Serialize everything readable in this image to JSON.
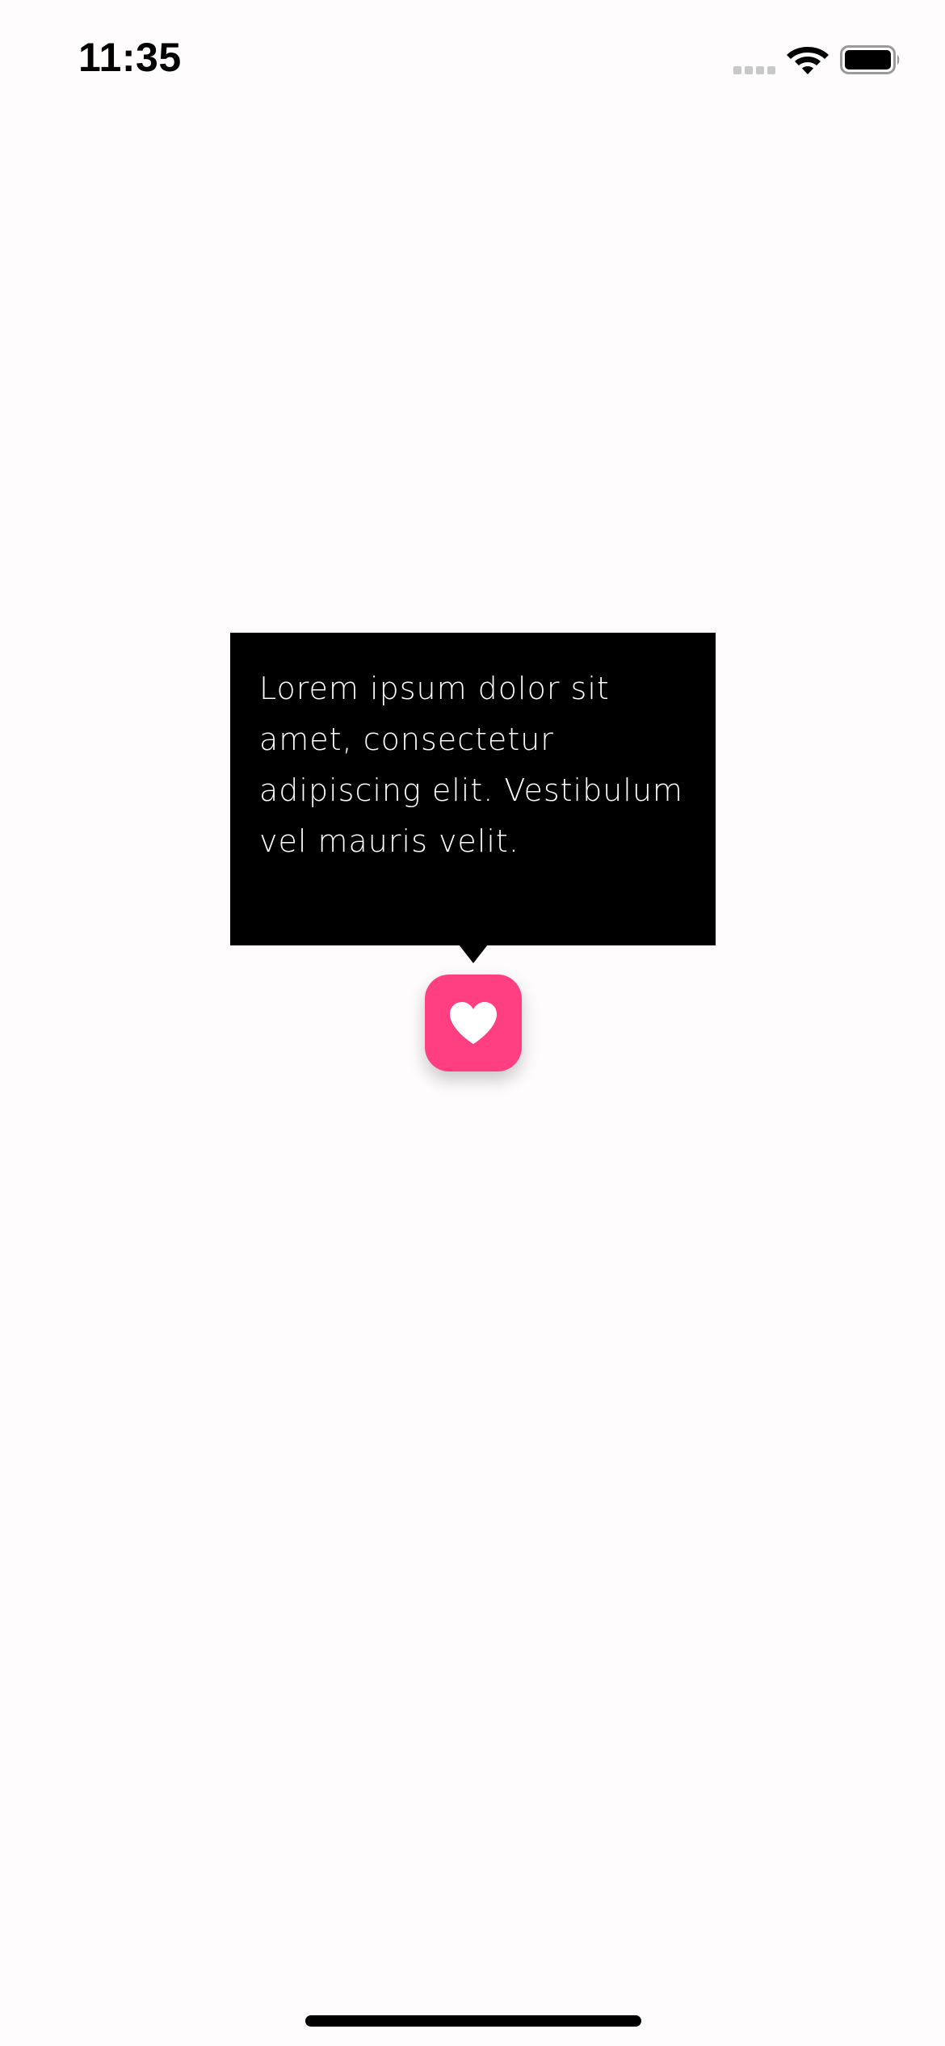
{
  "status_bar": {
    "time": "11:35",
    "icons": [
      "cellular-signal-icon",
      "wifi-icon",
      "battery-icon"
    ]
  },
  "tooltip": {
    "text": "Lorem ipsum dolor sit amet, consectetur adipiscing elit. Vestibulum vel mauris velit.",
    "background_color": "#000000",
    "text_color": "#ffffff"
  },
  "favorite_button": {
    "icon": "heart-icon",
    "color": "#ff3f81"
  },
  "colors": {
    "page_background": "#fefcfd",
    "accent": "#ff3f81"
  }
}
